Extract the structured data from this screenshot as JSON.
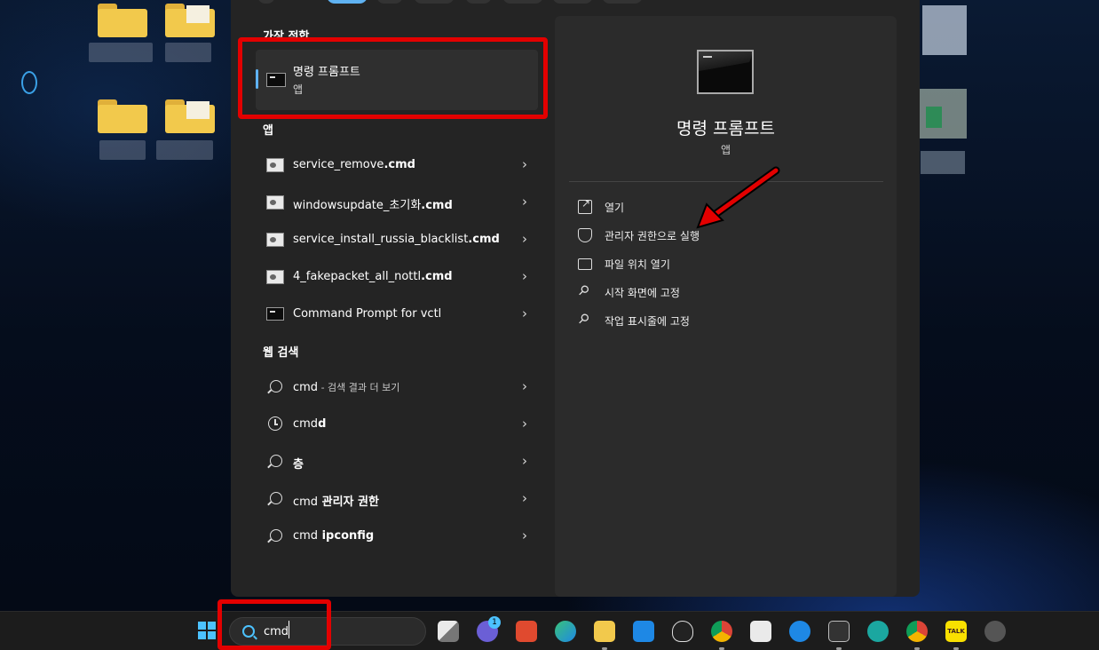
{
  "start_menu": {
    "best_match": {
      "section_title": "가장 적합",
      "app_name": "명령 프롬프트",
      "app_type": "앱"
    },
    "apps_section": {
      "title": "앱",
      "items": [
        {
          "name": "service_remove",
          "ext": ".cmd",
          "icon": "script-file-icon"
        },
        {
          "name": "windowsupdate_초기화",
          "ext": ".cmd",
          "icon": "script-file-icon"
        },
        {
          "name": "service_install_russia_blacklist",
          "ext": ".cmd",
          "icon": "script-file-icon"
        },
        {
          "name": "4_fakepacket_all_nottl",
          "ext": ".cmd",
          "icon": "script-file-icon"
        },
        {
          "name": "Command Prompt for vctl",
          "ext": "",
          "icon": "cmd-icon"
        }
      ]
    },
    "web_section": {
      "title": "웹 검색",
      "items": [
        {
          "prefix": "cmd",
          "suffix": " - 검색 결과 더 보기",
          "icon": "search-icon"
        },
        {
          "prefix": "cmd",
          "suffix": "d",
          "icon": "history-icon"
        },
        {
          "prefix": "",
          "suffix": "층",
          "icon": "search-icon"
        },
        {
          "prefix": "cmd",
          "suffix": " 관리자 권한",
          "icon": "search-icon"
        },
        {
          "prefix": "cmd",
          "suffix": " ipconfig",
          "icon": "search-icon"
        }
      ]
    },
    "detail": {
      "title": "명령 프롬프트",
      "subtitle": "앱",
      "actions": [
        {
          "label": "열기",
          "icon": "open-icon"
        },
        {
          "label": "관리자 권한으로 실행",
          "icon": "shield-icon"
        },
        {
          "label": "파일 위치 열기",
          "icon": "folder-icon"
        },
        {
          "label": "시작 화면에 고정",
          "icon": "pin-icon"
        },
        {
          "label": "작업 표시줄에 고정",
          "icon": "pin-icon"
        }
      ]
    }
  },
  "taskbar": {
    "search_query": "cmd",
    "chat_badge": "1",
    "apps": [
      "task-view-icon",
      "teams-chat-icon",
      "app-red-icon",
      "edge-icon",
      "file-explorer-icon",
      "mail-icon",
      "alienware-icon",
      "chrome-icon",
      "microsoft-store-icon",
      "app-blue-icon",
      "terminal-icon",
      "app-teal-icon",
      "chrome-profile-icon",
      "kakaotalk-icon",
      "app-gray-icon"
    ],
    "kakaotalk_label": "TALK"
  },
  "colors": {
    "accent": "#5fb2f2",
    "annotation_red": "#e30000",
    "panel_bg": "#242424"
  }
}
